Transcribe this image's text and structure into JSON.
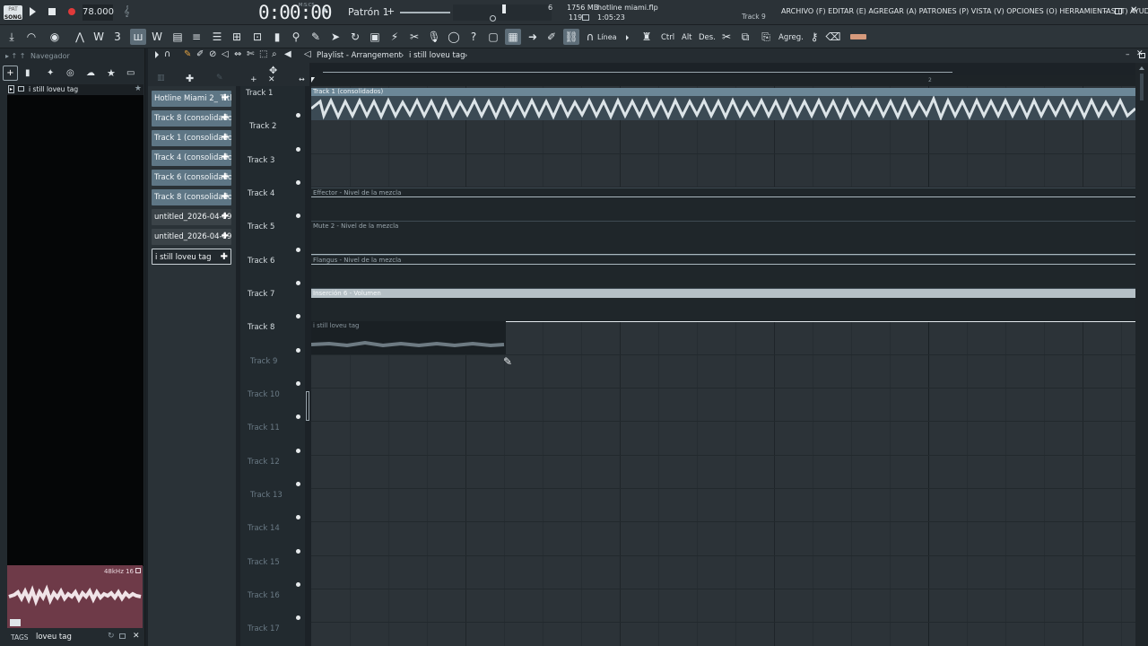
{
  "transport": {
    "mode": "SONG",
    "pat_label": "PAT",
    "tempo": "78.000",
    "time": "0:00:00",
    "time_unit": "M:S:CS",
    "pattern": "Patrón 1",
    "step": "6",
    "memory": "1756 MB",
    "cpu": "119",
    "project": "hotline miami.flp",
    "duration": "1:05:23",
    "hint_track": "Track 9"
  },
  "menu": [
    "ARCHIVO (F)",
    "EDITAR (E)",
    "AGREGAR (A)",
    "PATRONES (P)",
    "VISTA (V)",
    "OPCIONES (O)",
    "HERRAMIENTAS (T)",
    "AYUDA"
  ],
  "toolbar": {
    "line_label": "Línea",
    "ctrl": "Ctrl",
    "alt": "Alt",
    "des": "Des.",
    "agreg": "Agreg."
  },
  "browser": {
    "title": "Navegador",
    "tree_item": "i still loveu tag",
    "sample_info": "48kHz 16",
    "tags_label": "TAGS",
    "tags_value": "loveu tag"
  },
  "playlist": {
    "breadcrumb": [
      "Playlist - Arrangement",
      "i still loveu tag"
    ],
    "ruler_marker": "2"
  },
  "clips": [
    "Hotline Miami 2_ Titl..",
    "Track 8 (consolidados)",
    "Track 1 (consolidados)",
    "Track 4 (consolidados)",
    "Track 6 (consolidados)",
    "Track 8 (consolidado..",
    "untitled_2026-04-09 12-..",
    "untitled_2026-04-09..",
    "i still loveu tag"
  ],
  "tracks": [
    "Track 1",
    "Track 2",
    "Track 3",
    "Track 4",
    "Track 5",
    "Track 6",
    "Track 7",
    "Track 8",
    "Track 9",
    "Track 10",
    "Track 11",
    "Track 12",
    "Track 13",
    "Track 14",
    "Track 15",
    "Track 16",
    "Track 17"
  ],
  "arrangement_clips": {
    "track1": "Track 1 (consolidados)",
    "effector": "Effector - Nivel de la mezcla",
    "mute2": "Mute 2 - Nivel de la mezcla",
    "flangus": "Flangus - Nivel de la mezcla",
    "insercion": "Inserción 6 - Volumen",
    "tag": "i still loveu tag"
  },
  "colors": {
    "clip_blue": "#5e7685",
    "accent_red": "#e03a3a"
  }
}
